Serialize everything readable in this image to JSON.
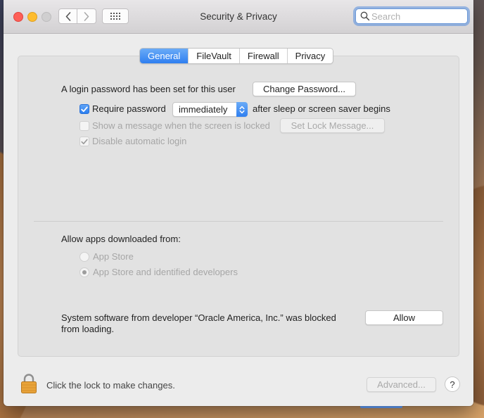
{
  "window": {
    "title": "Security & Privacy"
  },
  "toolbar": {
    "search_placeholder": "Search"
  },
  "tabs": [
    {
      "label": "General",
      "active": true
    },
    {
      "label": "FileVault",
      "active": false
    },
    {
      "label": "Firewall",
      "active": false
    },
    {
      "label": "Privacy",
      "active": false
    }
  ],
  "general": {
    "login_password_text": "A login password has been set for this user",
    "change_password_label": "Change Password...",
    "require_password_label": "Require password",
    "require_password_checked": true,
    "require_password_select_value": "immediately",
    "after_sleep_text": "after sleep or screen saver begins",
    "show_message_label": "Show a message when the screen is locked",
    "set_lock_message_label": "Set Lock Message...",
    "disable_auto_login_label": "Disable automatic login"
  },
  "apps": {
    "heading": "Allow apps downloaded from:",
    "options": [
      {
        "label": "App Store",
        "selected": false
      },
      {
        "label": "App Store and identified developers",
        "selected": true
      }
    ]
  },
  "blocked": {
    "line1": "System software from developer “Oracle America, Inc.” was blocked",
    "line2": "from loading.",
    "allow_label": "Allow"
  },
  "footer": {
    "lock_text": "Click the lock to make changes.",
    "advanced_label": "Advanced...",
    "help_label": "?"
  },
  "colors": {
    "accent": "#2f7ff0",
    "close": "#fe5f57",
    "minimize": "#febc2e",
    "lock": "#e8a33a"
  }
}
